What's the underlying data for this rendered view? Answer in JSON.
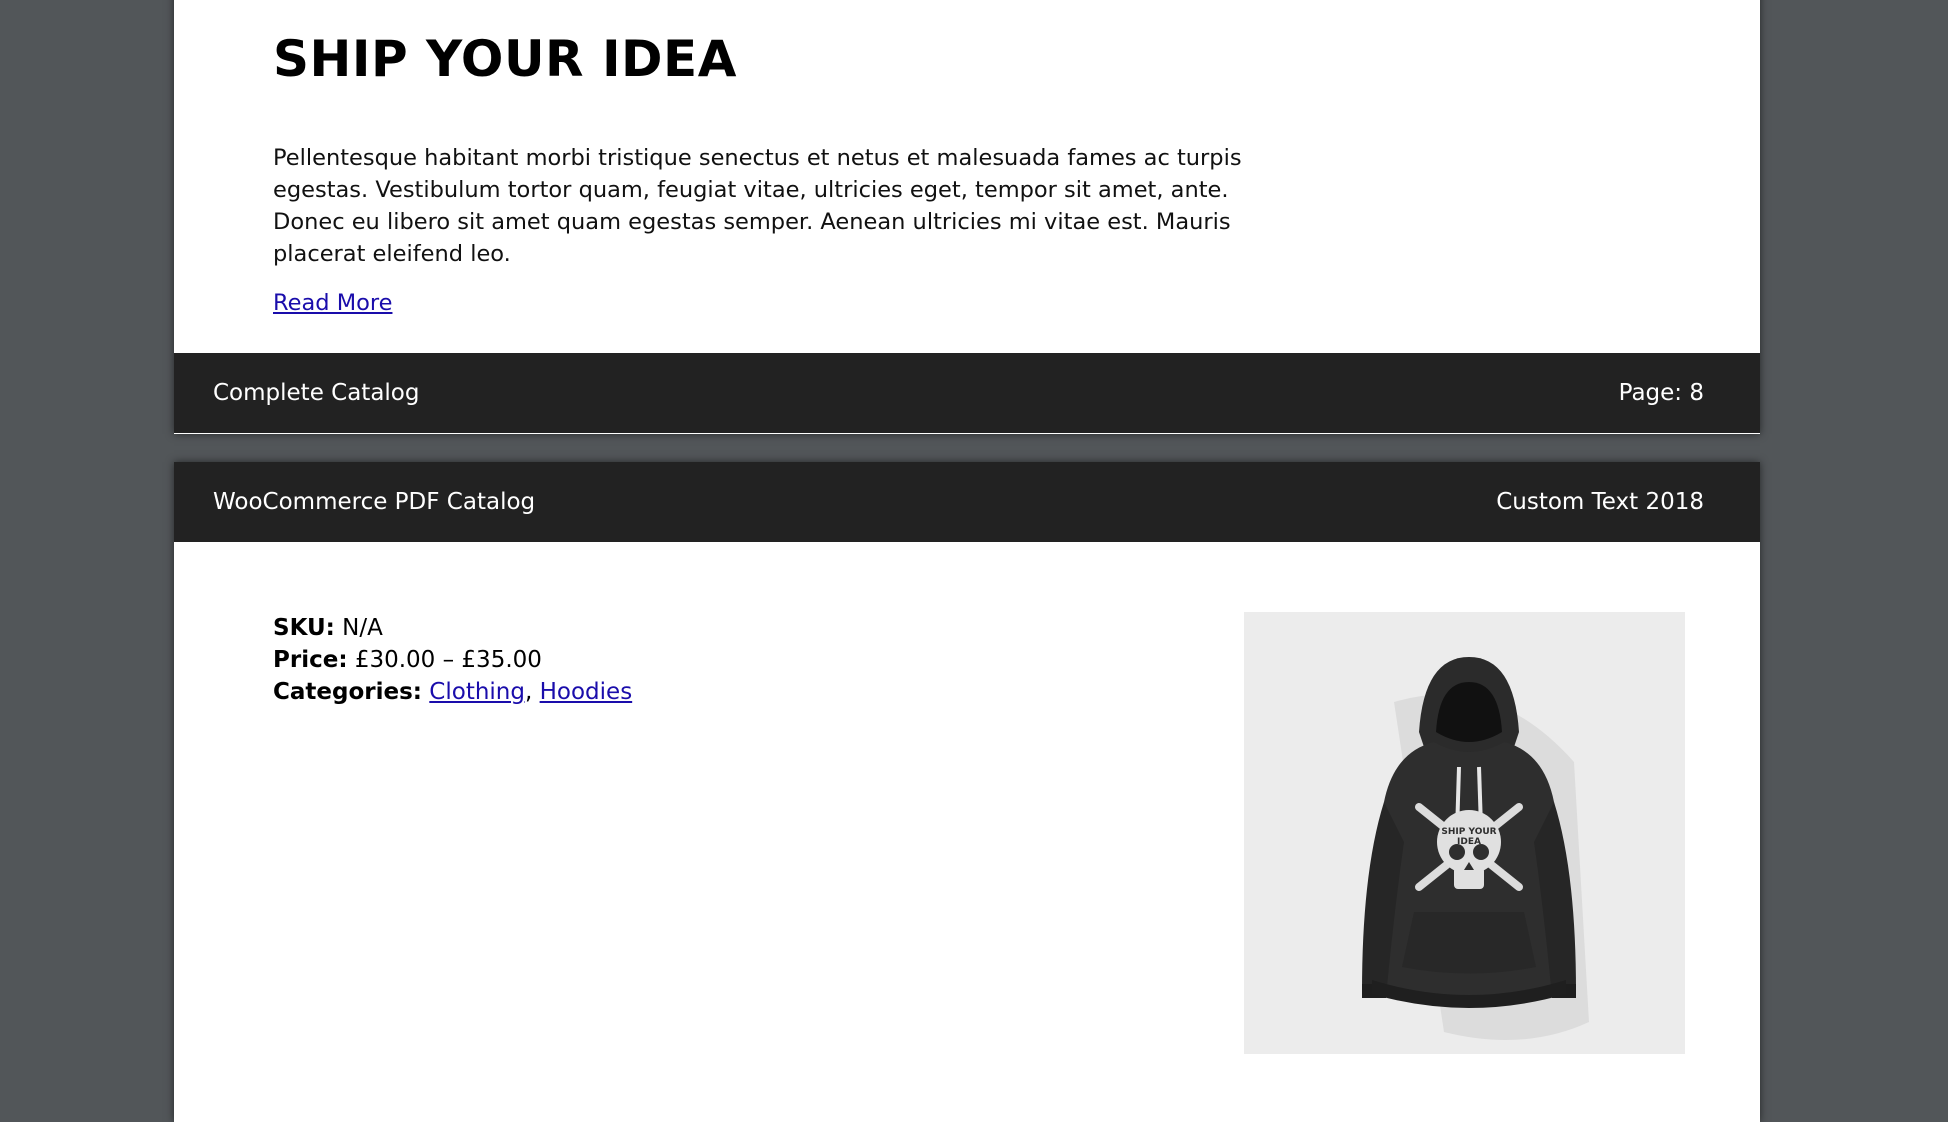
{
  "page1": {
    "title": "SHIP YOUR IDEA",
    "description": "Pellentesque habitant morbi tristique senectus et netus et malesuada fames ac turpis egestas. Vestibulum tortor quam, feugiat vitae, ultricies eget, tempor sit amet, ante. Donec eu libero sit amet quam egestas semper. Aenean ultricies mi vitae est. Mauris placerat eleifend leo.",
    "read_more": "Read More",
    "footer": {
      "left": "Complete Catalog",
      "right": "Page: 8"
    }
  },
  "page2": {
    "header": {
      "left": "WooCommerce PDF Catalog",
      "right": "Custom Text 2018"
    },
    "product": {
      "sku_label": "SKU:",
      "sku_value": "N/A",
      "price_label": "Price:",
      "price_value": "£30.00 – £35.00",
      "categories_label": "Categories:",
      "categories": [
        "Clothing",
        "Hoodies"
      ],
      "category_separator": ",",
      "image_alt": "hoodie-image",
      "image_print": "SHIP YOUR IDEA"
    }
  },
  "colors": {
    "viewer_background": "#525659",
    "bar_background": "#222222",
    "link": "#1a0dab"
  }
}
